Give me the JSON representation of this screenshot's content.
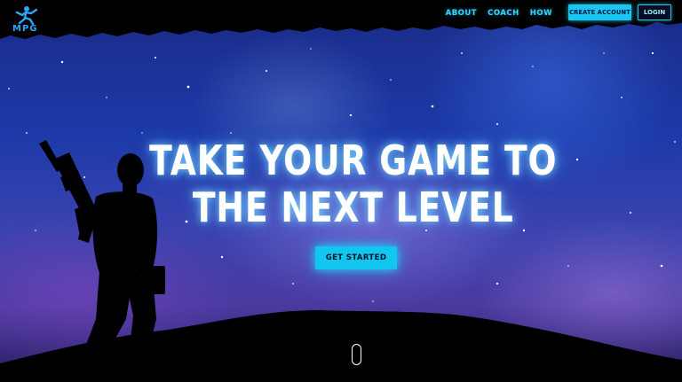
{
  "brand": {
    "logo_text": "MPG",
    "logo_icon": "runner-icon"
  },
  "nav": {
    "links": [
      {
        "label": "ABOUT"
      },
      {
        "label": "COACH"
      },
      {
        "label": "HOW"
      }
    ],
    "create_account_label": "CREATE ACCOUNT",
    "login_label": "LOGIN"
  },
  "hero": {
    "headline_line1": "TAKE YOUR GAME TO",
    "headline_line2": "THE NEXT LEVEL",
    "cta_label": "GET STARTED",
    "scroll_icon": "mouse-scroll-icon"
  },
  "colors": {
    "accent": "#17c7f2",
    "nav_text": "#38d7ff",
    "background": "#1c3aa8"
  }
}
